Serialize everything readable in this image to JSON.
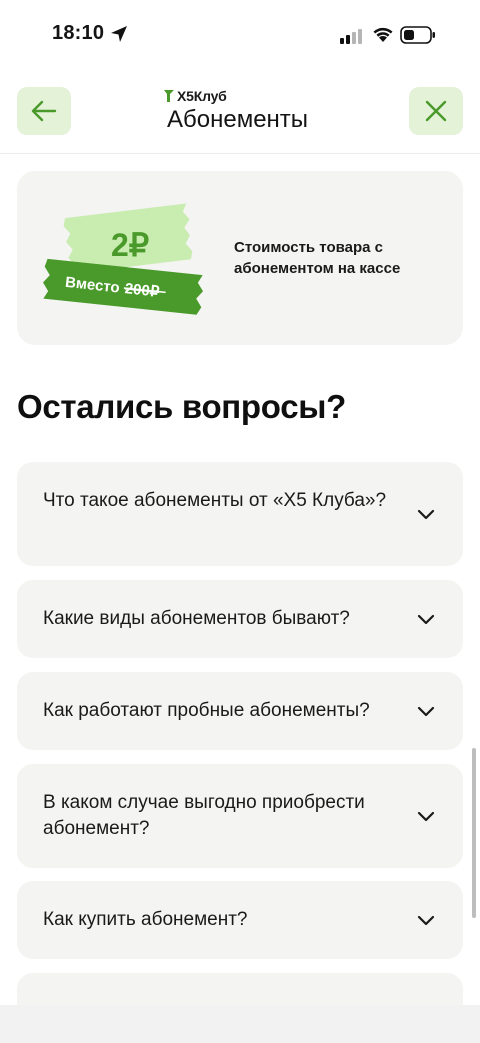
{
  "status_bar": {
    "time": "18:10"
  },
  "header": {
    "logo_text": "Х5Клуб",
    "title": "Абонементы"
  },
  "promo": {
    "price": "2₽",
    "instead_label": "Вместо",
    "old_price": "200₽",
    "description": "Стоимость товара с абонементом на кассе",
    "colors": {
      "accent": "#4a9a2b",
      "ticket_light": "#c9ecb0"
    }
  },
  "faq": {
    "title": "Остались вопросы?",
    "items": [
      {
        "question": "Что такое абонементы от «Х5 Клуба»?"
      },
      {
        "question": "Какие виды абонементов бывают?"
      },
      {
        "question": "Как работают пробные абонементы?"
      },
      {
        "question": "В каком случае выгодно приобрести абонемент?"
      },
      {
        "question": "Как купить абонемент?"
      }
    ]
  },
  "colors": {
    "brand_green": "#4a9a2b",
    "button_bg": "#e4f2d8",
    "card_bg": "#f4f4f2"
  }
}
